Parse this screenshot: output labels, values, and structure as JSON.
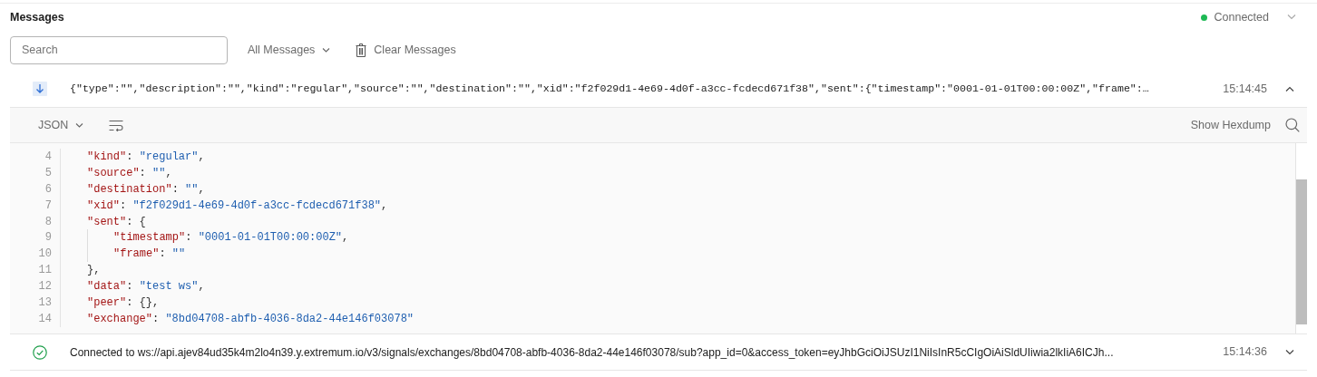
{
  "panel": {
    "title": "Messages"
  },
  "connection": {
    "status": "Connected",
    "connected": true
  },
  "toolbar": {
    "search": {
      "placeholder": "Search"
    },
    "filter": "All Messages",
    "clear": "Clear Messages"
  },
  "messages": [
    {
      "kind": "received",
      "text": "{\"type\":\"\",\"description\":\"\",\"kind\":\"regular\",\"source\":\"\",\"destination\":\"\",\"xid\":\"f2f029d1-4e69-4d0f-a3cc-fcdecd671f38\",\"sent\":{\"timestamp\":\"0001-01-01T00:00:00Z\",\"frame\":…",
      "time": "15:14:45",
      "expanded": true,
      "viewer": {
        "format": "JSON",
        "hexdump": "Show Hexdump",
        "lines": [
          {
            "number": "4",
            "tokens": [
              {
                "kind": "key",
                "text": "\"kind\""
              },
              {
                "kind": "punct",
                "text": ": "
              },
              {
                "kind": "string",
                "text": "\"regular\""
              },
              {
                "kind": "punct",
                "text": ","
              }
            ]
          },
          {
            "number": "5",
            "tokens": [
              {
                "kind": "key",
                "text": "\"source\""
              },
              {
                "kind": "punct",
                "text": ": "
              },
              {
                "kind": "string",
                "text": "\"\""
              },
              {
                "kind": "punct",
                "text": ","
              }
            ]
          },
          {
            "number": "6",
            "tokens": [
              {
                "kind": "key",
                "text": "\"destination\""
              },
              {
                "kind": "punct",
                "text": ": "
              },
              {
                "kind": "string",
                "text": "\"\""
              },
              {
                "kind": "punct",
                "text": ","
              }
            ]
          },
          {
            "number": "7",
            "tokens": [
              {
                "kind": "key",
                "text": "\"xid\""
              },
              {
                "kind": "punct",
                "text": ": "
              },
              {
                "kind": "string",
                "text": "\"f2f029d1-4e69-4d0f-a3cc-fcdecd671f38\""
              },
              {
                "kind": "punct",
                "text": ","
              }
            ]
          },
          {
            "number": "8",
            "tokens": [
              {
                "kind": "key",
                "text": "\"sent\""
              },
              {
                "kind": "punct",
                "text": ": {"
              }
            ],
            "children": [
              {
                "number": "9",
                "tokens": [
                  {
                    "kind": "key",
                    "text": "\"timestamp\""
                  },
                  {
                    "kind": "punct",
                    "text": ": "
                  },
                  {
                    "kind": "string",
                    "text": "\"0001-01-01T00:00:00Z\""
                  },
                  {
                    "kind": "punct",
                    "text": ","
                  }
                ]
              },
              {
                "number": "10",
                "tokens": [
                  {
                    "kind": "key",
                    "text": "\"frame\""
                  },
                  {
                    "kind": "punct",
                    "text": ": "
                  },
                  {
                    "kind": "string",
                    "text": "\"\""
                  }
                ]
              }
            ]
          },
          {
            "number": "11",
            "tokens": [
              {
                "kind": "punct",
                "text": "},"
              }
            ]
          },
          {
            "number": "12",
            "tokens": [
              {
                "kind": "key",
                "text": "\"data\""
              },
              {
                "kind": "punct",
                "text": ": "
              },
              {
                "kind": "string",
                "text": "\"test ws\""
              },
              {
                "kind": "punct",
                "text": ","
              }
            ]
          },
          {
            "number": "13",
            "tokens": [
              {
                "kind": "key",
                "text": "\"peer\""
              },
              {
                "kind": "punct",
                "text": ": {},"
              }
            ]
          },
          {
            "number": "14",
            "tokens": [
              {
                "kind": "key",
                "text": "\"exchange\""
              },
              {
                "kind": "punct",
                "text": ": "
              },
              {
                "kind": "string",
                "text": "\"8bd04708-abfb-4036-8da2-44e146f03078\""
              }
            ]
          }
        ]
      }
    },
    {
      "kind": "connected",
      "text": "Connected to ws://api.ajev84ud35k4m2lo4n39.y.extremum.io/v3/signals/exchanges/8bd04708-abfb-4036-8da2-44e146f03078/sub?app_id=0&access_token=eyJhbGciOiJSUzI1NiIsInR5cCIgOiAiSldUIiwia2lkIiA6ICJh...",
      "time": "15:14:36",
      "expanded": false
    }
  ]
}
